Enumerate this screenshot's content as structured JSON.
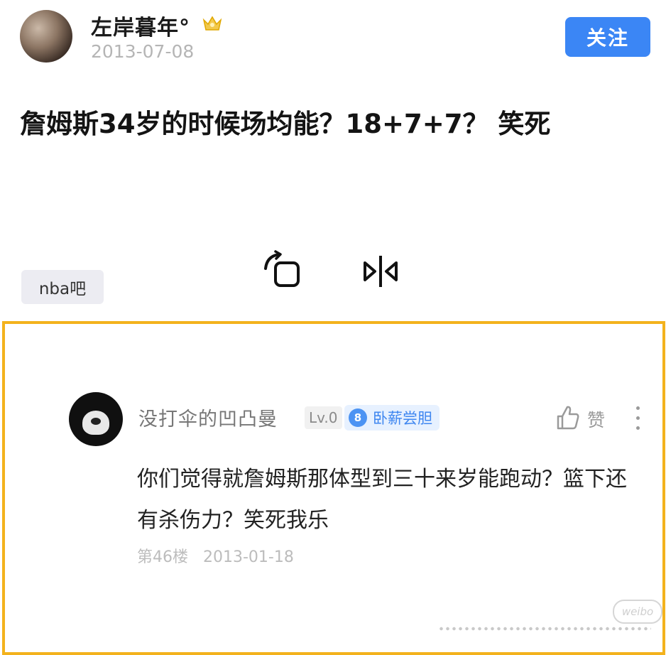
{
  "post": {
    "author": "左岸暮年°",
    "date": "2013-07-08",
    "follow_label": "关注",
    "text": "詹姆斯34岁的时候场均能？18+7+7？ 笑死",
    "tag": "nba吧",
    "icons": [
      "avatar-image",
      "crown-icon",
      "rotate-icon",
      "mirror-icon"
    ]
  },
  "comment": {
    "username": "没打伞的凹凸曼",
    "level": "Lv.0",
    "badge_number": "8",
    "badge_label": "卧薪尝胆",
    "like_label": "赞",
    "text": "你们觉得就詹姆斯那体型到三十来岁能跑动？篮下还有杀伤力？笑死我乐",
    "floor": "第46楼",
    "date": "2013-01-18",
    "watermark": "weibo",
    "icons": [
      "avatar-image",
      "thumbs-up-icon",
      "more-vertical-icon"
    ]
  },
  "colors": {
    "highlight_border": "#f3b21c",
    "follow_button": "#3b86f5",
    "badge_text": "#3e86f0"
  }
}
